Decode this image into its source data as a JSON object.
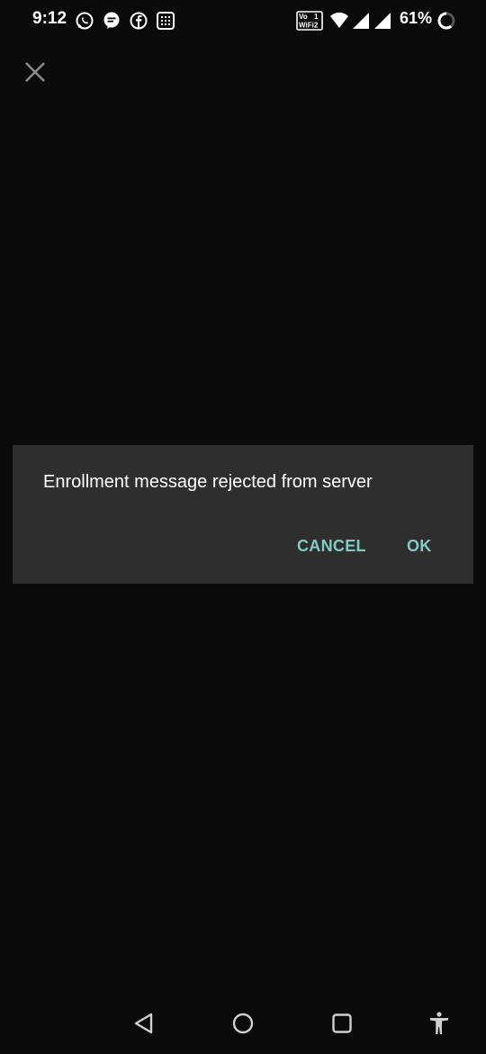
{
  "status_bar": {
    "time": "9:12",
    "volte_label": "Voₑ 1\nWiFi 2",
    "battery_percent": "61%",
    "left_icons": [
      "whatsapp-icon",
      "messages-icon",
      "facebook-icon",
      "grid-app-icon"
    ],
    "right_icons": [
      "volte-wifi-icon",
      "wifi-icon",
      "signal-icon",
      "signal-icon-2",
      "battery-ring-icon"
    ]
  },
  "toolbar": {
    "close_icon": "close-icon"
  },
  "dialog": {
    "message": "Enrollment message rejected from server",
    "cancel_label": "CANCEL",
    "ok_label": "OK",
    "accent_color": "#80cbc4",
    "background_color": "#2e2e2e"
  },
  "nav_bar": {
    "icons": [
      "back-icon",
      "home-icon",
      "recents-icon",
      "accessibility-icon"
    ]
  }
}
